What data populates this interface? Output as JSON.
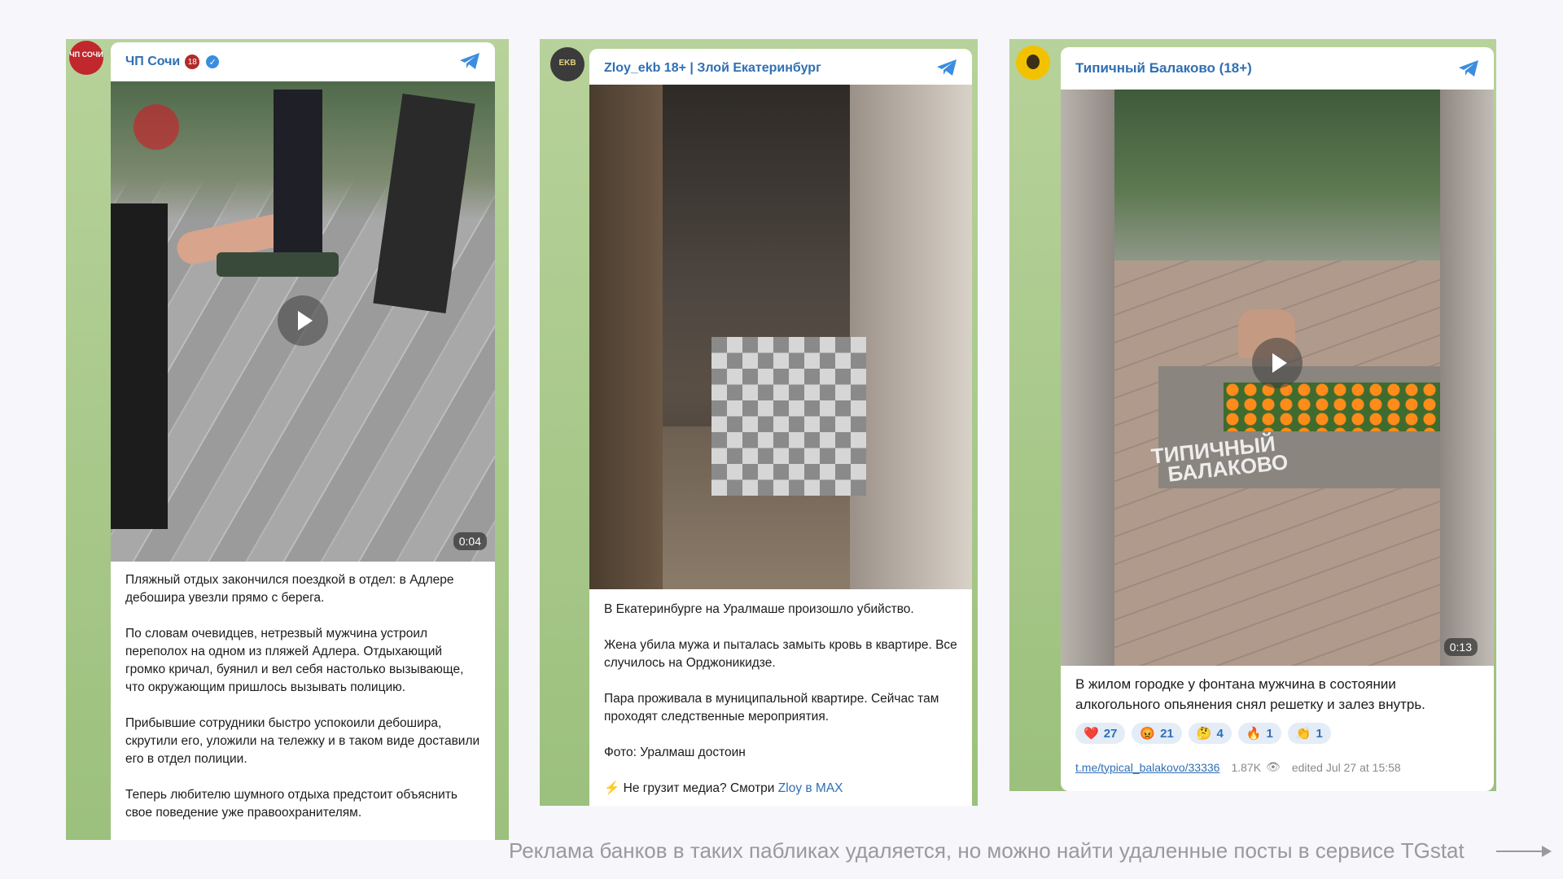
{
  "posts": [
    {
      "channel": "ЧП Сочи",
      "badge": "18",
      "avatar_text": "ЧП СОЧИ",
      "duration": "0:04",
      "text": [
        "Пляжный отдых закончился поездкой в отдел: в Адлере дебошира увезли прямо с берега.",
        "По словам очевидцев, нетрезвый мужчина устроил переполох на одном из пляжей Адлера. Отдыхающий громко кричал, буянил и вел себя настолько вызывающе, что окружающим пришлось вызывать полицию.",
        "Прибывшие сотрудники быстро успокоили дебошира, скрутили его, уложили на тележку и в таком виде доставили его в отдел полиции.",
        "Теперь любителю шумного отдыха предстоит объяснить свое поведение уже правоохранителям."
      ]
    },
    {
      "channel": "Zloy_ekb 18+ | Злой Екатеринбург",
      "avatar_text": "EKB",
      "text": [
        "В Екатеринбурге на Уралмаше произошло убийство.",
        "Жена убила мужа и пыталась замыть кровь в квартире. Все случилось на Орджоникидзе.",
        "Пара проживала в муниципальной квартире. Сейчас там проходят следственные мероприятия.",
        "Фото: Уралмаш достоин"
      ],
      "footer_icon": "⚡",
      "footer_prefix": "Не грузит медиа? Смотри",
      "footer_link": "Zloy в MAX"
    },
    {
      "channel": "Типичный Балаково (18+)",
      "duration": "0:13",
      "watermark_line1": "ТИПИЧНЫЙ",
      "watermark_line2": "БАЛАКОВО",
      "text": [
        "В жилом городке у фонтана мужчина в состоянии алкогольного опьянения снял решетку и залез внутрь."
      ],
      "reactions": [
        {
          "emoji": "❤️",
          "count": "27"
        },
        {
          "emoji": "😡",
          "count": "21"
        },
        {
          "emoji": "🤔",
          "count": "4"
        },
        {
          "emoji": "🔥",
          "count": "1"
        },
        {
          "emoji": "👏",
          "count": "1"
        }
      ],
      "link": "t.me/typical_balakovo/33336",
      "views": "1.87K",
      "edited": "edited  Jul 27 at 15:58"
    }
  ],
  "caption": "Реклама банков в таких пабликах удаляется, но можно найти удаленные посты в сервисе TGstat",
  "colors": {
    "accent": "#2f6fb4",
    "panel": "#a9c98c"
  }
}
